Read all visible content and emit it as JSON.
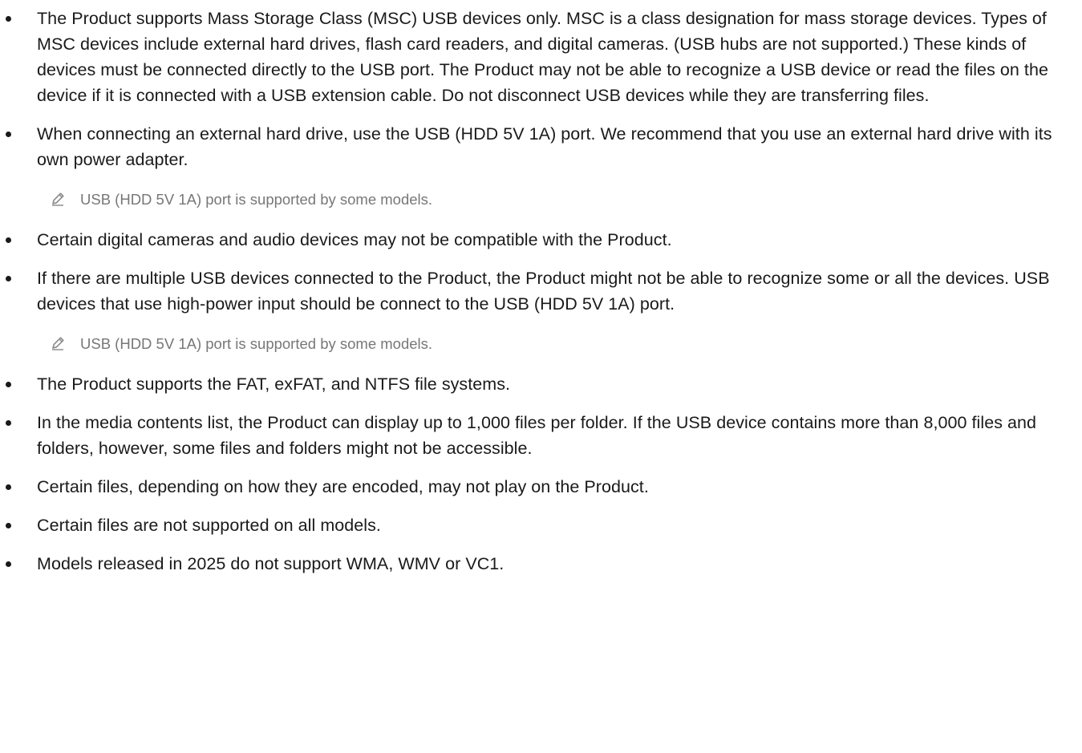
{
  "items": [
    {
      "text": "The Product supports Mass Storage Class (MSC) USB devices only. MSC is a class designation for mass storage devices. Types of MSC devices include external hard drives, flash card readers, and digital cameras. (USB hubs are not supported.) These kinds of devices must be connected directly to the USB port. The Product may not be able to recognize a USB device or read the files on the device if it is connected with a USB extension cable. Do not disconnect USB devices while they are transferring files."
    },
    {
      "text": "When connecting an external hard drive, use the USB (HDD 5V 1A) port. We recommend that you use an external hard drive with its own power adapter.",
      "note": "USB (HDD 5V 1A) port is supported by some models."
    },
    {
      "text": "Certain digital cameras and audio devices may not be compatible with the Product."
    },
    {
      "text": "If there are multiple USB devices connected to the Product, the Product might not be able to recognize some or all the devices. USB devices that use high-power input should be connect to the USB (HDD 5V 1A) port.",
      "note": "USB (HDD 5V 1A) port is supported by some models."
    },
    {
      "text": "The Product supports the FAT, exFAT, and NTFS file systems."
    },
    {
      "text": "In the media contents list, the Product can display up to 1,000 files per folder. If the USB device contains more than 8,000 files and folders, however, some files and folders might not be accessible."
    },
    {
      "text": "Certain files, depending on how they are encoded, may not play on the Product."
    },
    {
      "text": "Certain files are not supported on all models."
    },
    {
      "text": "Models released in 2025 do not support WMA, WMV or VC1."
    }
  ],
  "icons": {
    "note": "pencil-icon"
  },
  "colors": {
    "text": "#1a1a1a",
    "note_text": "#777777"
  }
}
